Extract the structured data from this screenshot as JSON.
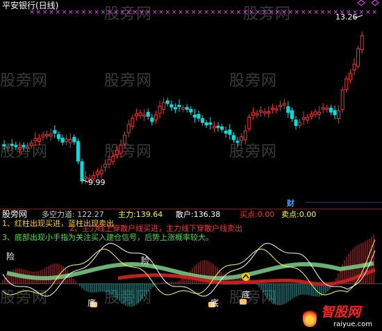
{
  "window_title": "平安银行(日线)",
  "price_high_label": "13.26",
  "price_low_label": "9.99",
  "cai_badge": "财",
  "sub_panel_name": "股旁网",
  "indicators": [
    {
      "label": "多空力道:",
      "value": "122.27",
      "color": "#c8c8c8"
    },
    {
      "label": "主力:",
      "value": "139.64",
      "color": "#ffff00"
    },
    {
      "label": "散户:",
      "value": "136.38",
      "color": "#ffffff"
    },
    {
      "label": "买点:",
      "value": "0.00",
      "color": "#ff3030"
    },
    {
      "label": "卖点:",
      "value": "0.00",
      "color": "#ffff00"
    }
  ],
  "notes": [
    {
      "text": "1、红柱出现买进，蓝柱出现卖出",
      "color": "#ffd000"
    },
    {
      "text": "2、主力线上穿散户线买进，主力线下穿散户线卖出",
      "color": "#ff3030"
    },
    {
      "text": "3、底部出现小手指为关注买入建仓信号，后势上涨概率较大。",
      "color": "#40e040"
    }
  ],
  "signal_labels": {
    "danger1": "险",
    "danger2": "险",
    "bottom1": "底",
    "bottom2": "底",
    "bottom3": "底"
  },
  "watermark_text": "股旁网",
  "footer_logo": {
    "name": "智股网",
    "url": "raiyue.com"
  },
  "colors": {
    "up": "#ff3030",
    "down": "#00e0e0",
    "bg": "#000000",
    "ma_pink": "#ff44ff"
  }
}
